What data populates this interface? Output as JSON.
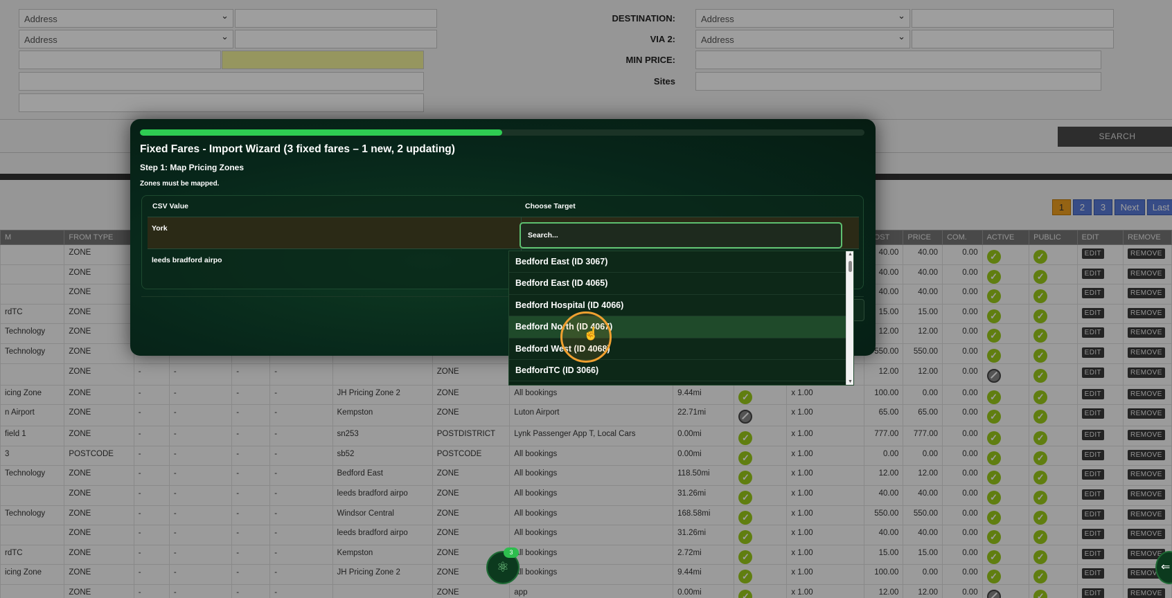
{
  "filters": {
    "left_selects": [
      "Address",
      "Address"
    ],
    "destination_label": "DESTINATION:",
    "destination_value": "Address",
    "via2_label": "VIA 2:",
    "via2_value": "Address",
    "min_price_label": "MIN PRICE:",
    "sites_label": "Sites",
    "search_button": "SEARCH"
  },
  "pagination": [
    "1",
    "2",
    "3",
    "Next",
    "Last"
  ],
  "table": {
    "headers": [
      "M",
      "FROM TYPE",
      "",
      "",
      "",
      "",
      "",
      "",
      "",
      "",
      "COST",
      "PRICE",
      "COM.",
      "ACTIVE",
      "PUBLIC",
      "EDIT",
      "REMOVE"
    ],
    "rows": [
      {
        "from": "",
        "type": "ZONE",
        "to": "",
        "totype": "",
        "account": "",
        "dist": "",
        "active_icon": "ok",
        "mult": "",
        "cost": "40.00",
        "price": "40.00",
        "com": "0.00",
        "active": "ok",
        "public": "ok"
      },
      {
        "from": "",
        "type": "ZONE",
        "to": "",
        "totype": "",
        "account": "",
        "dist": "",
        "active_icon": "ok",
        "mult": "",
        "cost": "40.00",
        "price": "40.00",
        "com": "0.00",
        "active": "ok",
        "public": "ok"
      },
      {
        "from": "",
        "type": "ZONE",
        "to": "",
        "totype": "",
        "account": "",
        "dist": "",
        "active_icon": "ok",
        "mult": "",
        "cost": "40.00",
        "price": "40.00",
        "com": "0.00",
        "active": "ok",
        "public": "ok"
      },
      {
        "from": "rdTC",
        "type": "ZONE",
        "to": "",
        "totype": "",
        "account": "",
        "dist": "",
        "active_icon": "ok",
        "mult": "",
        "cost": "15.00",
        "price": "15.00",
        "com": "0.00",
        "active": "ok",
        "public": "ok"
      },
      {
        "from": "Technology",
        "type": "ZONE",
        "to": "",
        "totype": "",
        "account": "",
        "dist": "",
        "active_icon": "ok",
        "mult": "",
        "cost": "12.00",
        "price": "12.00",
        "com": "0.00",
        "active": "ok",
        "public": "ok"
      },
      {
        "from": "Technology",
        "type": "ZONE",
        "to": "",
        "totype": "",
        "account": "",
        "dist": "",
        "active_icon": "ok",
        "mult": "",
        "cost": "550.00",
        "price": "550.00",
        "com": "0.00",
        "active": "ok",
        "public": "ok"
      },
      {
        "from": "",
        "type": "ZONE",
        "to": "",
        "totype": "ZONE",
        "account": "",
        "dist": "",
        "active_icon": "ok",
        "mult": "",
        "cost": "12.00",
        "price": "12.00",
        "com": "0.00",
        "active": "no",
        "public": "ok"
      },
      {
        "from": "icing Zone",
        "type": "ZONE",
        "to": "JH Pricing Zone 2",
        "totype": "ZONE",
        "account": "All bookings",
        "dist": "9.44mi",
        "active_icon": "ok",
        "mult": "x 1.00",
        "cost": "100.00",
        "price": "0.00",
        "com": "0.00",
        "active": "ok",
        "public": "ok"
      },
      {
        "from": "n Airport",
        "type": "ZONE",
        "to": "Kempston",
        "totype": "ZONE",
        "account": "Luton Airport",
        "dist": "22.71mi",
        "active_icon": "no",
        "mult": "x 1.00",
        "cost": "65.00",
        "price": "65.00",
        "com": "0.00",
        "active": "ok",
        "public": "ok"
      },
      {
        "from": "field 1",
        "type": "ZONE",
        "to": "sn253",
        "totype": "POSTDISTRICT",
        "account": "Lynk Passenger App T, Local Cars",
        "dist": "0.00mi",
        "active_icon": "ok",
        "mult": "x 1.00",
        "cost": "777.00",
        "price": "777.00",
        "com": "0.00",
        "active": "ok",
        "public": "ok"
      },
      {
        "from": "3",
        "type": "POSTCODE",
        "to": "sb52",
        "totype": "POSTCODE",
        "account": "All bookings",
        "dist": "0.00mi",
        "active_icon": "ok",
        "mult": "x 1.00",
        "cost": "0.00",
        "price": "0.00",
        "com": "0.00",
        "active": "ok",
        "public": "ok"
      },
      {
        "from": "Technology",
        "type": "ZONE",
        "to": "Bedford East",
        "totype": "ZONE",
        "account": "All bookings",
        "dist": "118.50mi",
        "active_icon": "ok",
        "mult": "x 1.00",
        "cost": "12.00",
        "price": "12.00",
        "com": "0.00",
        "active": "ok",
        "public": "ok"
      },
      {
        "from": "",
        "type": "ZONE",
        "to": "leeds bradford airpo",
        "totype": "ZONE",
        "account": "All bookings",
        "dist": "31.26mi",
        "active_icon": "ok",
        "mult": "x 1.00",
        "cost": "40.00",
        "price": "40.00",
        "com": "0.00",
        "active": "ok",
        "public": "ok"
      },
      {
        "from": "Technology",
        "type": "ZONE",
        "to": "Windsor Central",
        "totype": "ZONE",
        "account": "All bookings",
        "dist": "168.58mi",
        "active_icon": "ok",
        "mult": "x 1.00",
        "cost": "550.00",
        "price": "550.00",
        "com": "0.00",
        "active": "ok",
        "public": "ok"
      },
      {
        "from": "",
        "type": "ZONE",
        "to": "leeds bradford airpo",
        "totype": "ZONE",
        "account": "All bookings",
        "dist": "31.26mi",
        "active_icon": "ok",
        "mult": "x 1.00",
        "cost": "40.00",
        "price": "40.00",
        "com": "0.00",
        "active": "ok",
        "public": "ok"
      },
      {
        "from": "rdTC",
        "type": "ZONE",
        "to": "Kempston",
        "totype": "ZONE",
        "account": "All bookings",
        "dist": "2.72mi",
        "active_icon": "ok",
        "mult": "x 1.00",
        "cost": "15.00",
        "price": "15.00",
        "com": "0.00",
        "active": "ok",
        "public": "ok"
      },
      {
        "from": "icing Zone",
        "type": "ZONE",
        "to": "JH Pricing Zone 2",
        "totype": "ZONE",
        "account": "All bookings",
        "dist": "9.44mi",
        "active_icon": "ok",
        "mult": "x 1.00",
        "cost": "100.00",
        "price": "0.00",
        "com": "0.00",
        "active": "ok",
        "public": "ok"
      },
      {
        "from": "",
        "type": "ZONE",
        "to": "",
        "totype": "ZONE",
        "account": "app",
        "dist": "0.00mi",
        "active_icon": "ok",
        "mult": "x 1.00",
        "cost": "12.00",
        "price": "12.00",
        "com": "0.00",
        "active": "no",
        "public": "ok"
      }
    ],
    "dash": "-",
    "edit_label": "EDIT",
    "remove_label": "REMOVE"
  },
  "modal": {
    "progress": 0.5,
    "title": "Fixed Fares - Import Wizard (3 fixed fares – 1 new, 2 updating)",
    "step": "Step 1: Map Pricing Zones",
    "warning": "Zones must be mapped.",
    "col_csv": "CSV Value",
    "col_target": "Choose Target",
    "rows": [
      "York",
      "leeds bradford airpo"
    ],
    "search_placeholder": "Search...",
    "options": [
      "Bedford East (ID 3067)",
      "Bedford East (ID 4065)",
      "Bedford Hospital (ID 4066)",
      "Bedford North (ID 4067)",
      "Bedford West (ID 4068)",
      "BedfordTC (ID 3066)"
    ],
    "hovered_option": 3
  },
  "fab_badge": "3",
  "colors": {
    "accent_green": "#2ecc52",
    "active_ok": "#9ccc1a",
    "pager_current": "#f0a020",
    "pager": "#5a7bd8",
    "cursor_ring": "#f0a030"
  }
}
